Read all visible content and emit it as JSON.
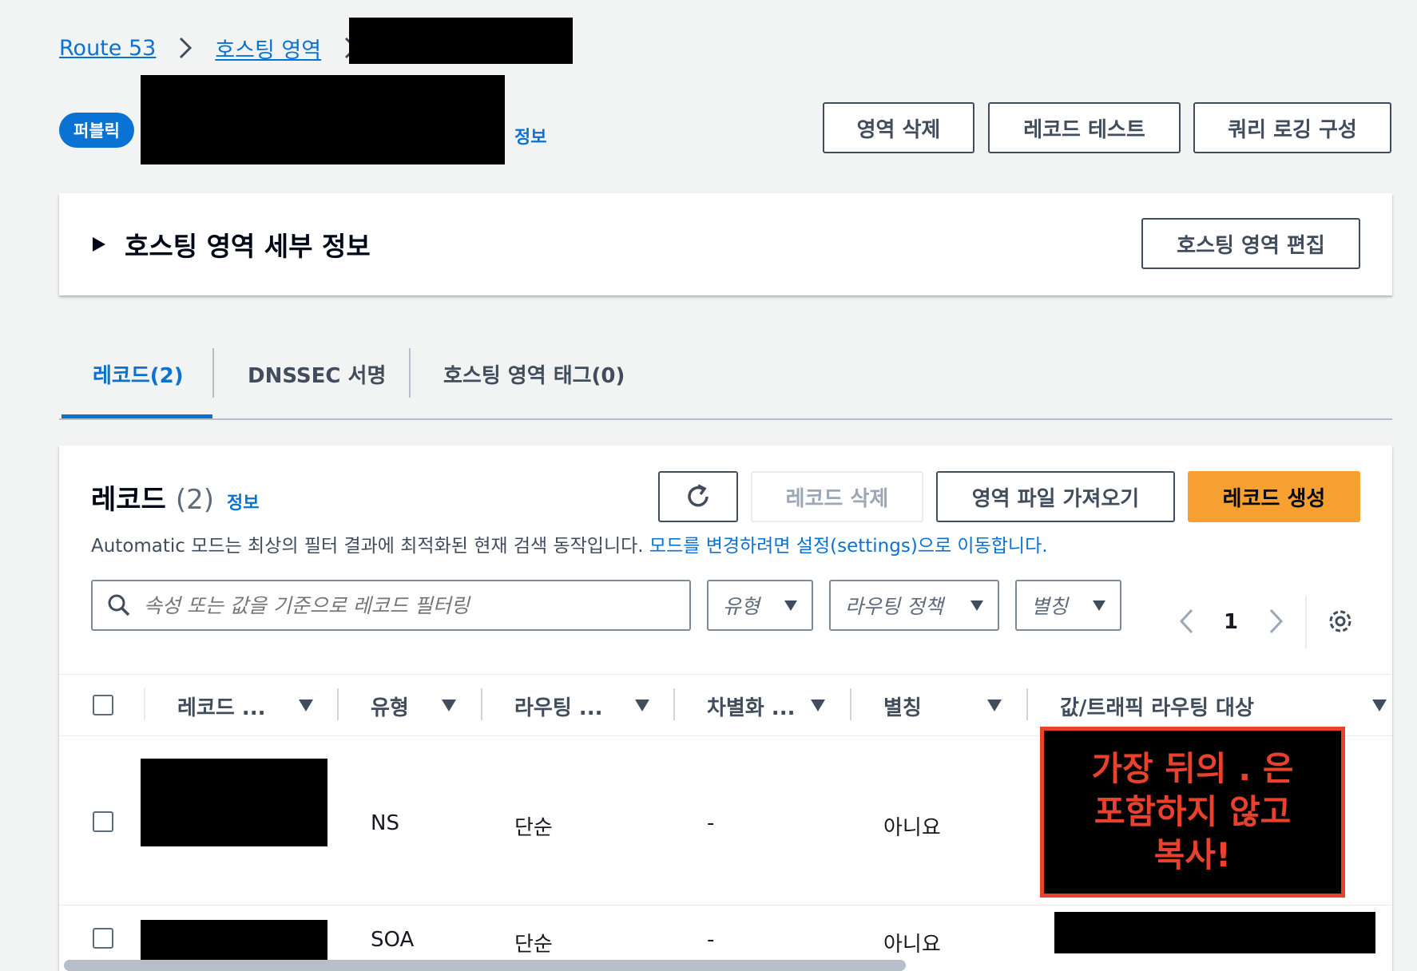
{
  "breadcrumb": {
    "root": "Route 53",
    "level2": "호스팅 영역"
  },
  "header": {
    "badge": "퍼블릭",
    "info": "정보",
    "buttons": {
      "delete_zone": "영역 삭제",
      "test_record": "레코드 테스트",
      "query_logging": "쿼리 로깅 구성"
    }
  },
  "details_panel": {
    "title": "호스팅 영역 세부 정보",
    "edit_button": "호스팅 영역 편집"
  },
  "tabs": [
    {
      "label": "레코드(2)",
      "active": true
    },
    {
      "label": "DNSSEC 서명",
      "active": false
    },
    {
      "label": "호스팅 영역 태그(0)",
      "active": false
    }
  ],
  "records": {
    "title": "레코드",
    "count": "(2)",
    "info": "정보",
    "buttons": {
      "delete": "레코드 삭제",
      "import": "영역 파일 가져오기",
      "create": "레코드 생성"
    },
    "description": "Automatic 모드는 최상의 필터 결과에 최적화된 현재 검색 동작입니다.",
    "description_link": "모드를 변경하려면 설정(settings)으로 이동합니다.",
    "search_placeholder": "속성 또는 값을 기준으로 레코드 필터링",
    "filters": {
      "type": "유형",
      "routing": "라우팅 정책",
      "alias": "별칭"
    },
    "page": "1",
    "columns": [
      "레코드 ...",
      "유형",
      "라우팅 ...",
      "차별화 ...",
      "별칭",
      "값/트래픽 라우팅 대상"
    ],
    "rows": [
      {
        "type": "NS",
        "routing": "단순",
        "diff": "-",
        "alias": "아니요"
      },
      {
        "type": "SOA",
        "routing": "단순",
        "diff": "-",
        "alias": "아니요"
      }
    ]
  },
  "annotation": {
    "line1": "가장 뒤의 . 은",
    "line2": "포함하지 않고",
    "line3": "복사!",
    "color": "#e8412c"
  }
}
